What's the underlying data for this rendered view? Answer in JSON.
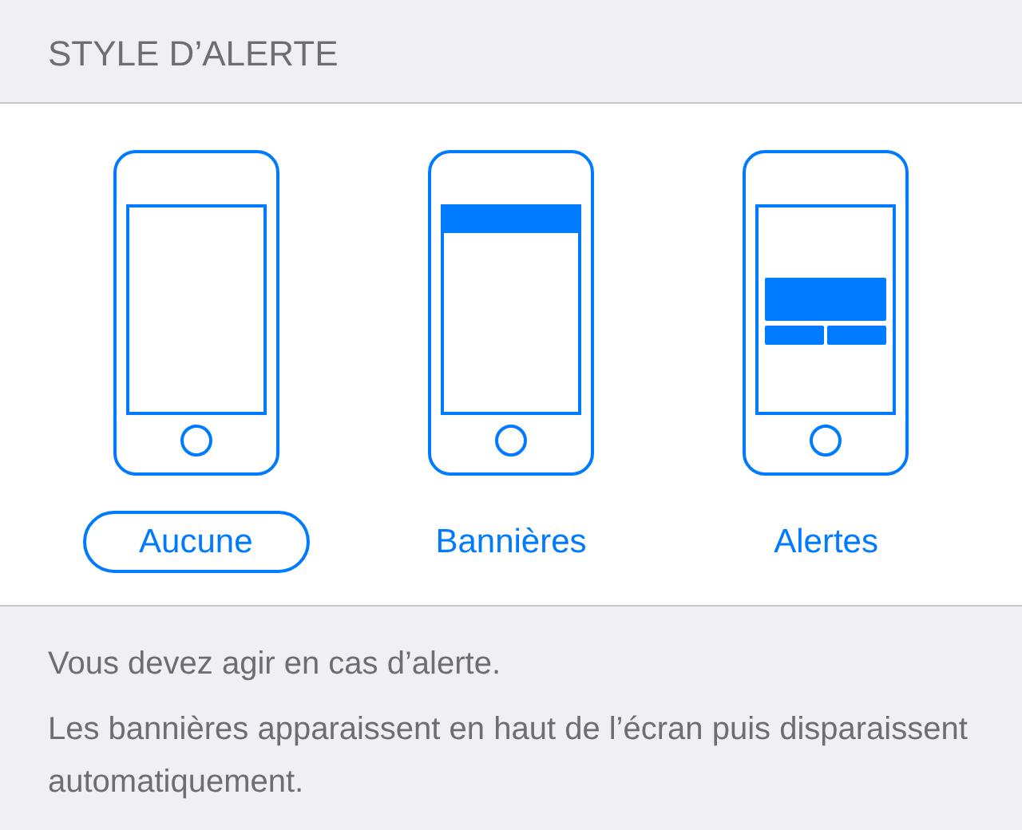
{
  "section_header": "STYLE D’ALERTE",
  "options": [
    {
      "kind": "none",
      "label": "Aucune",
      "selected": true
    },
    {
      "kind": "banner",
      "label": "Bannières",
      "selected": false
    },
    {
      "kind": "alert",
      "label": "Alertes",
      "selected": false
    }
  ],
  "footer": [
    "Vous devez agir en cas d’alerte.",
    "Les bannières apparaissent en haut de l’écran puis disparaissent automatiquement."
  ]
}
